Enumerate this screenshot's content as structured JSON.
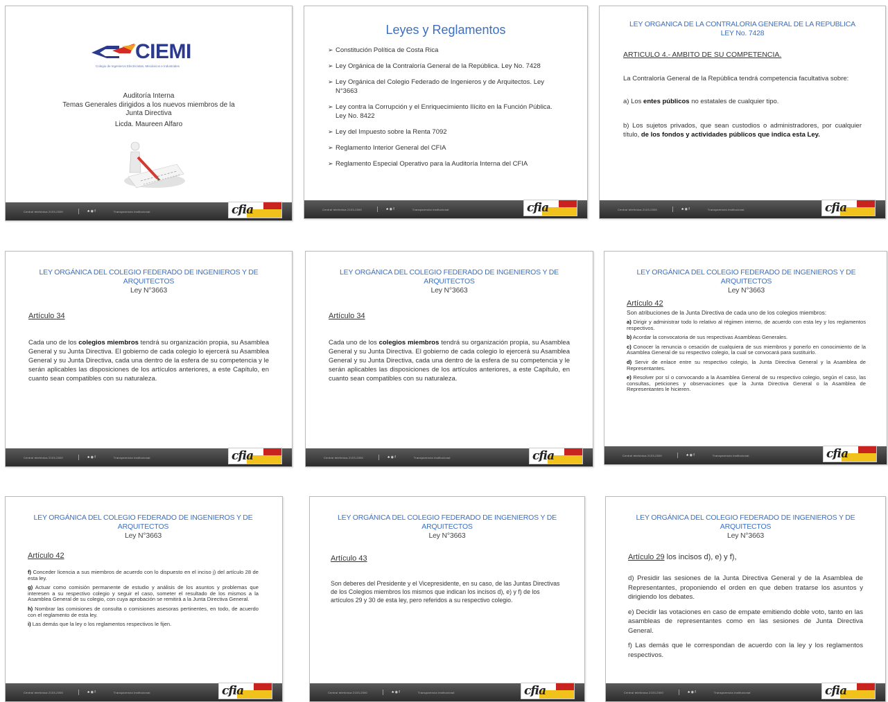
{
  "footer": {
    "segment_1": "Central telefónica 2103-2000",
    "segment_2": "Transparencia institucional",
    "social": "♣ ◉ f",
    "logo_text": "cfia"
  },
  "slide1": {
    "logo_text": "CIEMI",
    "logo_tagline": "Colegio de Ingenieros Electricistas, Mecánicos e Industriales",
    "line1": "Auditoría Interna",
    "line2": "Temas Generales dirigidos a los nuevos miembros de la",
    "line3": "Junta Directiva",
    "line4": "Licda.  Maureen Alfaro"
  },
  "slide2": {
    "title": "Leyes y Reglamentos",
    "items": [
      "Constitución Política de Costa Rica",
      "Ley Orgánica de la Contraloría General de la República. Ley No. 7428",
      "Ley Orgánica del Colegio Federado de Ingenieros y de Arquitectos. Ley N°3663",
      "Ley contra la Corrupción y el Enriquecimiento Ilícito en la Función Pública.  Ley No. 8422",
      "Ley del Impuesto sobre la Renta 7092",
      "Reglamento Interior General del  CFIA",
      "Reglamento Especial Operativo para la Auditoría Interna del CFIA"
    ]
  },
  "slide3": {
    "title_line1": "LEY ORGANICA DE LA CONTRALORIA GENERAL DE LA REPUBLICA",
    "title_line2": "LEY No. 7428",
    "heading": "ARTICULO 4.- AMBITO DE SU COMPETENCIA.",
    "intro": "La Contraloría General de la República tendrá competencia facultativa sobre:",
    "a_pre": "a) Los ",
    "a_bold": "entes públicos",
    "a_post": " no estatales de cualquier tipo.",
    "b_pre": "b) Los sujetos privados, que sean custodios o administradores, por cualquier título, ",
    "b_bold": "de los fondos y actividades públicos que indica esta Ley."
  },
  "law_title": {
    "line1": "LEY ORGÁNICA DEL COLEGIO FEDERADO DE INGENIEROS Y   DE",
    "line2": "ARQUITECTOS",
    "line3": "Ley N°3663"
  },
  "slide4": {
    "heading": "Artículo 34",
    "p_pre": "Cada uno de los ",
    "p_bold": "colegios miembros",
    "p_post": " tendrá su organización propia, su Asamblea General y su Junta Directiva. El gobierno de cada colegio lo ejercerá su Asamblea General y su Junta Directiva, cada una dentro de la esfera de su competencia y le serán aplicables las disposiciones de los artículos anteriores, a este Capítulo, en cuanto sean compatibles con su naturaleza."
  },
  "slide6": {
    "heading": "Artículo 42",
    "intro": "Son atribuciones de la Junta Directiva de cada uno de los colegios miembros:",
    "items": [
      {
        "label": "a)",
        "text": " Dirigir y administrar todo lo relativo al régimen interno, de acuerdo con esta ley y los reglamentos respectivos."
      },
      {
        "label": "b)",
        "text": " Acordar la convocatoria de sus respectivas Asambleas Generales."
      },
      {
        "label": "c)",
        "text": " Conocer la renuncia o cesación de cualquiera de sus miembros y ponerlo en conocimiento de la Asamblea General de su respectivo colegio, la cual se convocará para sustituirlo."
      },
      {
        "label": "d)",
        "text": " Servir de enlace entre su respectivo colegio, la Junta Directiva General y la Asamblea de Representantes."
      },
      {
        "label": "e)",
        "text": " Resolver por sí o convocando a la Asamblea General de su respectivo colegio, según el caso, las consultas, peticiones y observaciones que la Junta Directiva General o la Asamblea de Representantes le hicieren."
      }
    ]
  },
  "slide7": {
    "heading": "Artículo 42",
    "items": [
      {
        "label": "f)",
        "text": " Conceder licencia a sus miembros de acuerdo con lo dispuesto en el inciso j) del artículo 28 de esta ley."
      },
      {
        "label": "g)",
        "text": " Actuar como comisión permanente de estudio y análisis de los asuntos y problemas que interesen a su respectivo colegio y seguir el caso, someter el resultado de los mismos a la Asamblea General de su colegio, con cuya aprobación se remitirá a la Junta Directiva General."
      },
      {
        "label": "h)",
        "text": " Nombrar las comisiones de consulta o comisiones asesoras pertinentes, en todo, de acuerdo con el reglamento de esta ley."
      },
      {
        "label": "i)",
        "text": " Las demás que la ley o los reglamentos respectivos le fijen."
      }
    ]
  },
  "slide8": {
    "heading": "Artículo 43",
    "text": "Son deberes del Presidente y el Vicepresidente, en su caso, de las Juntas Directivas de los Colegios miembros los mismos que indican los incisos d), e) y f) de los artículos 29 y 30 de esta ley, pero referidos a su respectivo colegio."
  },
  "slide9": {
    "heading": "Artículo 29",
    "heading_rest": " los incisos d), e) y f),",
    "p1": "d) Presidir las sesiones de la Junta Directiva General y de la Asamblea de Representantes, proponiendo el orden en que deben tratarse los asuntos y dirigiendo los debates.",
    "p2": "e) Decidir las votaciones en caso de empate emitiendo doble voto, tanto en las asambleas de representantes como en las sesiones de Junta Directiva General.",
    "p3": "f) Las demás que le correspondan de acuerdo con la ley y los reglamentos respectivos."
  }
}
